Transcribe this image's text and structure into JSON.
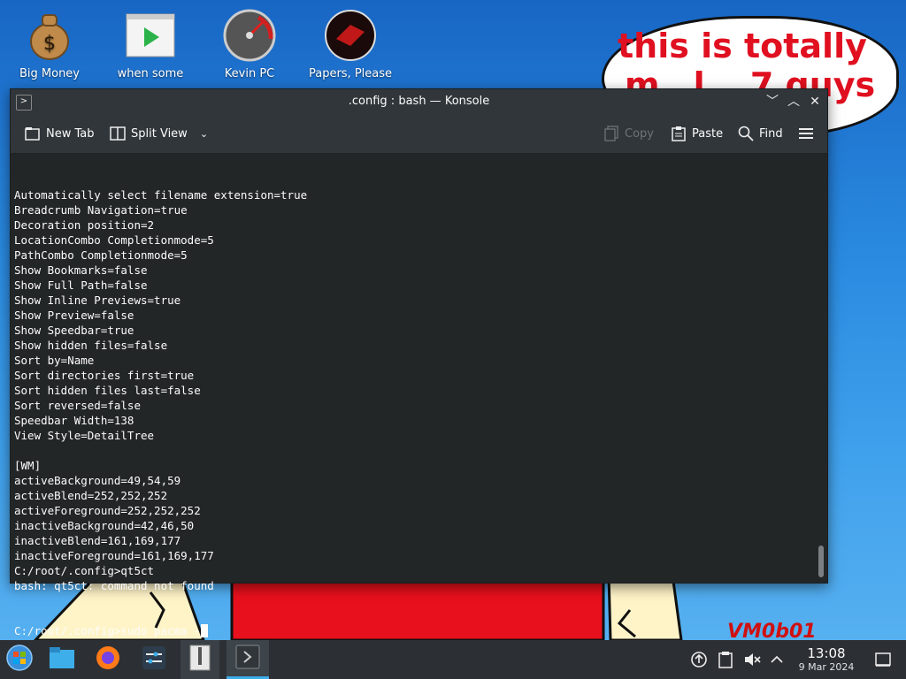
{
  "desktop": {
    "icons": [
      {
        "label": "Big Money",
        "icon": "money-bag-icon"
      },
      {
        "label": "when some",
        "icon": "video-play-icon"
      },
      {
        "label": "Kevin PC",
        "icon": "speedometer-icon"
      },
      {
        "label": "Papers, Please",
        "icon": "papers-please-icon"
      }
    ],
    "bubble_text": "this is totally ... 7 guys",
    "bubble_line1": "this is totally",
    "bubble_line2": "m…l… 7 guys",
    "watermark": "VM0b01"
  },
  "window": {
    "title": ".config : bash — Konsole",
    "controls": [
      "minimize",
      "maximize",
      "close"
    ]
  },
  "toolbar": {
    "new_tab": "New Tab",
    "split_view": "Split View",
    "copy": "Copy",
    "paste": "Paste",
    "find": "Find"
  },
  "terminal": {
    "lines": [
      "Automatically select filename extension=true",
      "Breadcrumb Navigation=true",
      "Decoration position=2",
      "LocationCombo Completionmode=5",
      "PathCombo Completionmode=5",
      "Show Bookmarks=false",
      "Show Full Path=false",
      "Show Inline Previews=true",
      "Show Preview=false",
      "Show Speedbar=true",
      "Show hidden files=false",
      "Sort by=Name",
      "Sort directories first=true",
      "Sort hidden files last=false",
      "Sort reversed=false",
      "Speedbar Width=138",
      "View Style=DetailTree",
      "",
      "[WM]",
      "activeBackground=49,54,59",
      "activeBlend=252,252,252",
      "activeForeground=252,252,252",
      "inactiveBackground=42,46,50",
      "inactiveBlend=161,169,177",
      "inactiveForeground=161,169,177",
      "C:/root/.config>qt5ct",
      "bash: qt5ct: command not found"
    ],
    "prompt_line": "C:/root/.config>sudo pacma -"
  },
  "taskbar": {
    "items": [
      "start-menu",
      "file-manager",
      "firefox",
      "settings",
      "archive",
      "konsole"
    ],
    "clock_time": "13:08",
    "clock_date": "9 Mar 2024"
  },
  "colors": {
    "terminal_bg": "#232627",
    "window_bg": "#31363b",
    "accent": "#3daee9"
  }
}
